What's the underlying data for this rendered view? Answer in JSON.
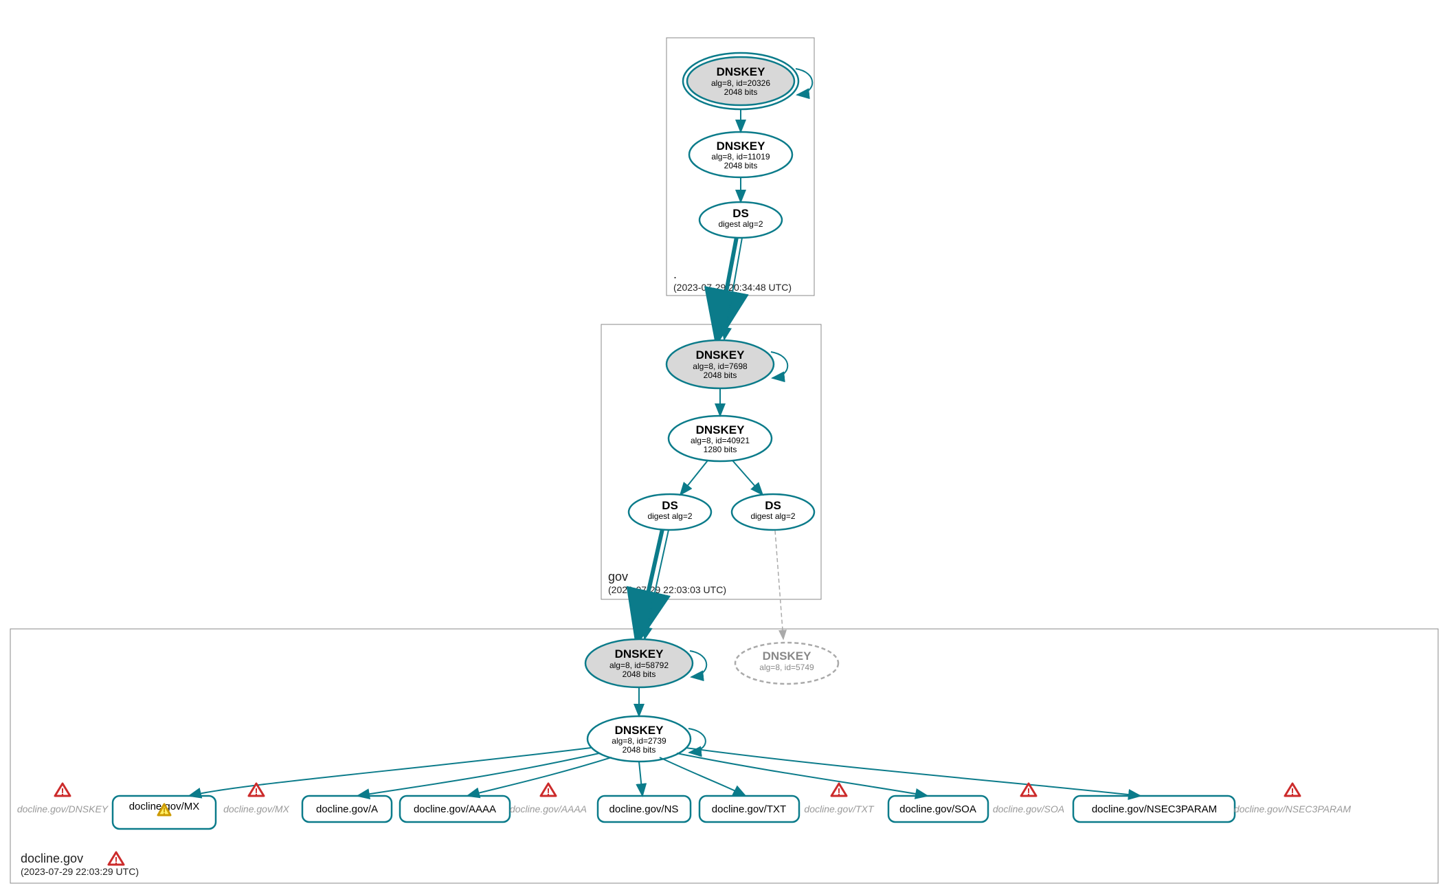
{
  "zones": {
    "root": {
      "name": ".",
      "timestamp": "(2023-07-29 20:34:48 UTC)"
    },
    "gov": {
      "name": "gov",
      "timestamp": "(2023-07-29 22:03:03 UTC)"
    },
    "docline": {
      "name": "docline.gov",
      "timestamp": "(2023-07-29 22:03:29 UTC)"
    }
  },
  "nodes": {
    "root_ksk": {
      "title": "DNSKEY",
      "line1": "alg=8, id=20326",
      "line2": "2048 bits"
    },
    "root_zsk": {
      "title": "DNSKEY",
      "line1": "alg=8, id=11019",
      "line2": "2048 bits"
    },
    "root_ds": {
      "title": "DS",
      "line1": "digest alg=2"
    },
    "gov_ksk": {
      "title": "DNSKEY",
      "line1": "alg=8, id=7698",
      "line2": "2048 bits"
    },
    "gov_zsk": {
      "title": "DNSKEY",
      "line1": "alg=8, id=40921",
      "line2": "1280 bits"
    },
    "gov_ds1": {
      "title": "DS",
      "line1": "digest alg=2"
    },
    "gov_ds2": {
      "title": "DS",
      "line1": "digest alg=2"
    },
    "doc_ksk": {
      "title": "DNSKEY",
      "line1": "alg=8, id=58792",
      "line2": "2048 bits"
    },
    "doc_zsk": {
      "title": "DNSKEY",
      "line1": "alg=8, id=2739",
      "line2": "2048 bits"
    },
    "doc_grey": {
      "title": "DNSKEY",
      "line1": "alg=8, id=5749"
    }
  },
  "rrsets": {
    "mx": "docline.gov/MX",
    "a": "docline.gov/A",
    "aaaa": "docline.gov/AAAA",
    "ns": "docline.gov/NS",
    "txt": "docline.gov/TXT",
    "soa": "docline.gov/SOA",
    "nsec3": "docline.gov/NSEC3PARAM"
  },
  "ghosts": {
    "dnskey": "docline.gov/DNSKEY",
    "mx": "docline.gov/MX",
    "aaaa": "docline.gov/AAAA",
    "txt": "docline.gov/TXT",
    "soa": "docline.gov/SOA",
    "nsec3": "docline.gov/NSEC3PARAM"
  }
}
